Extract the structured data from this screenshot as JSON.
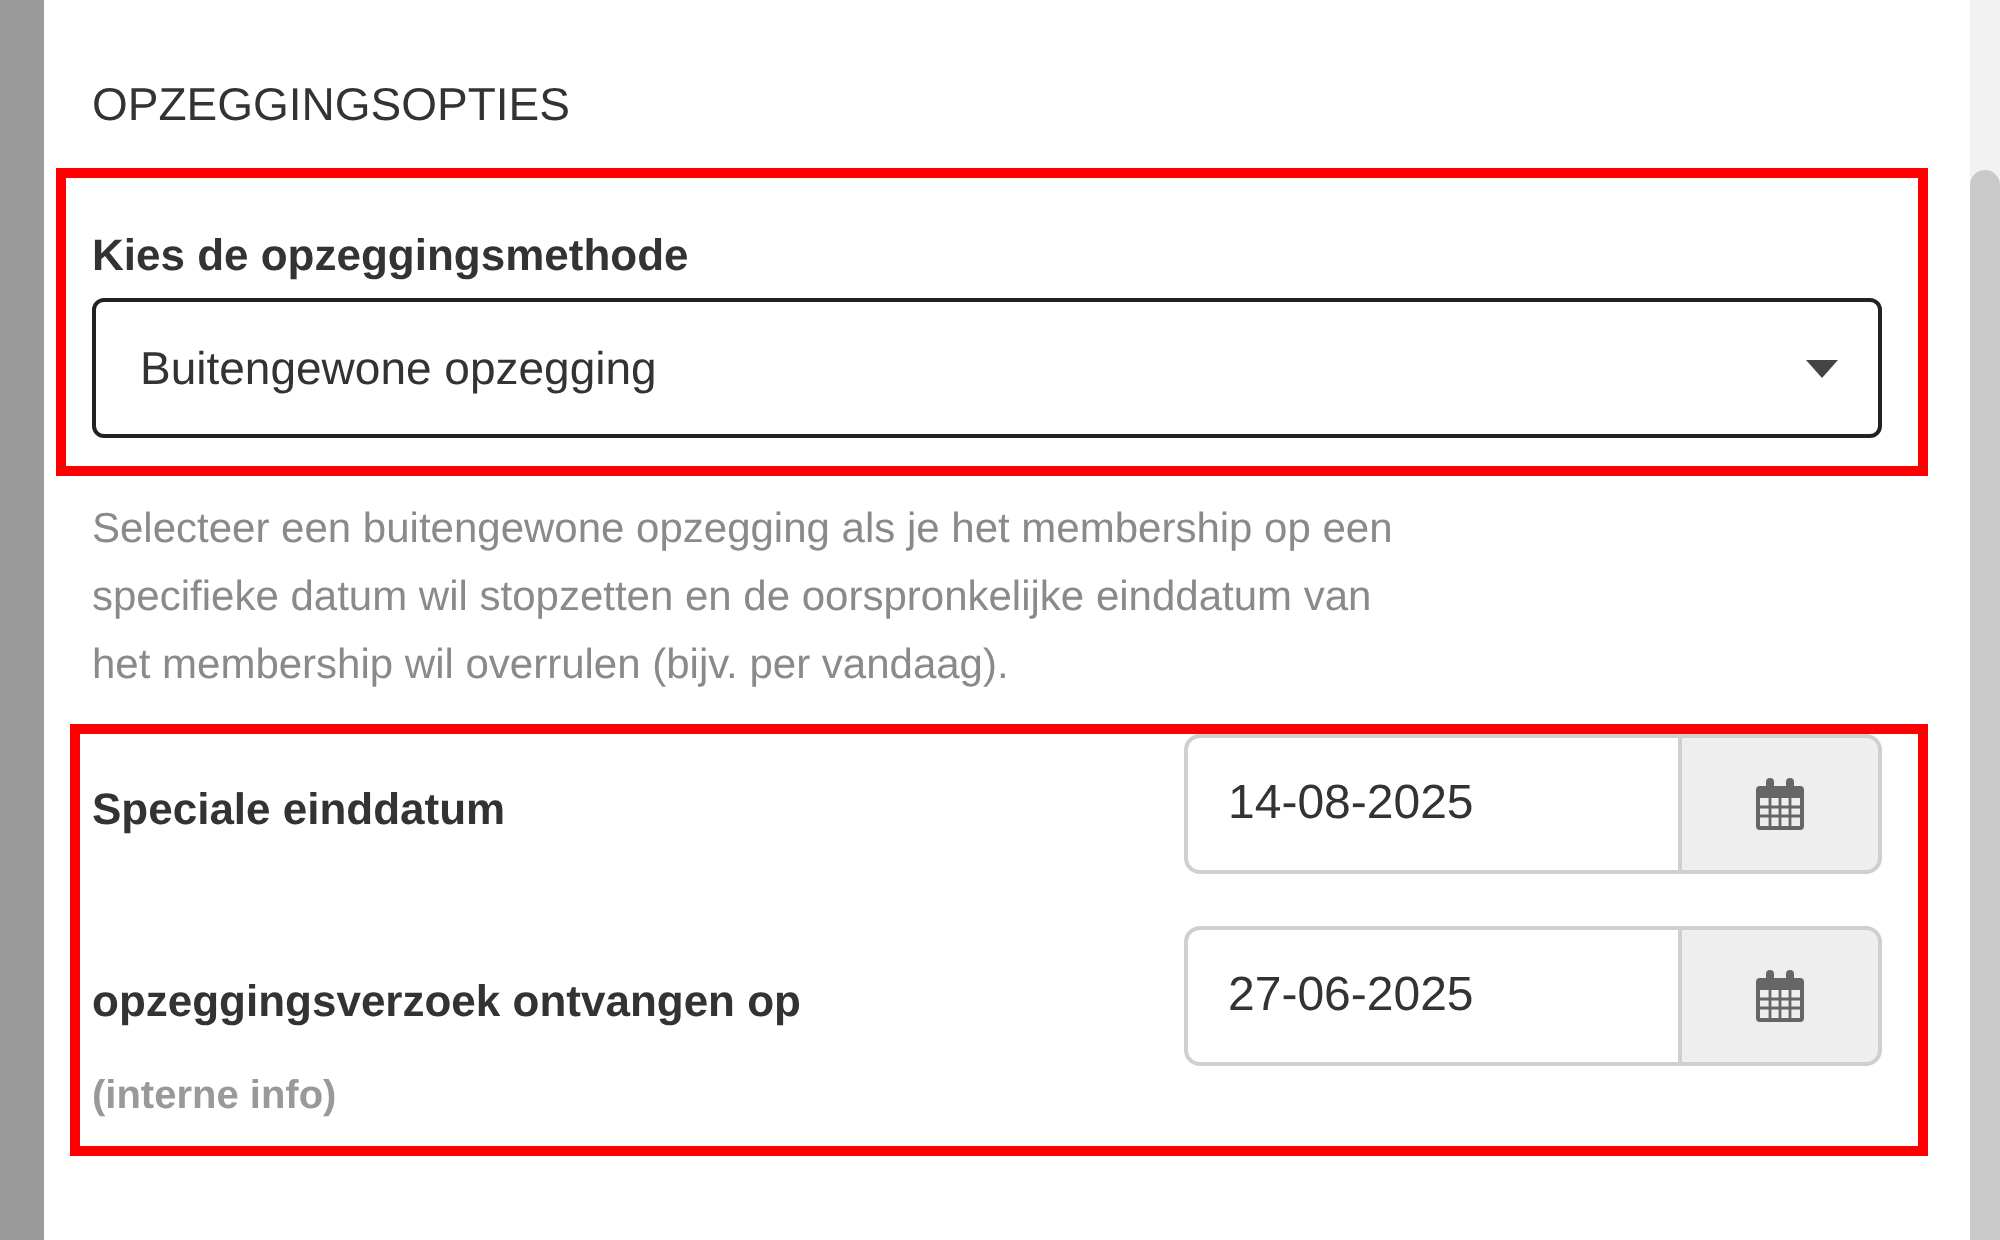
{
  "section_title": "OPZEGGINGSOPTIES",
  "method": {
    "label": "Kies de opzeggingsmethode",
    "value": "Buitengewone opzegging",
    "highlighted": true
  },
  "help_text": "Selecteer een buitengewone opzegging als je het membership op een specifieke datum wil stopzetten en de oorspronkelijke einddatum van het membership wil overrulen (bijv. per vandaag).",
  "dates_highlighted": true,
  "dates": [
    {
      "label": "Speciale einddatum",
      "value": "14-08-2025"
    },
    {
      "label": "opzeggingsverzoek ontvangen op",
      "note": "(interne info)",
      "value": "27-06-2025"
    }
  ]
}
